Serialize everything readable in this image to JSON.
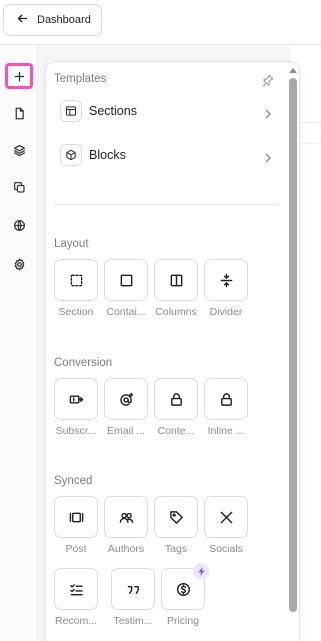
{
  "header": {
    "back_label": "Dashboard"
  },
  "rail": {
    "items": [
      {
        "name": "add",
        "active": true
      },
      {
        "name": "page"
      },
      {
        "name": "layers"
      },
      {
        "name": "copy"
      },
      {
        "name": "globe"
      },
      {
        "name": "settings"
      }
    ],
    "accent_color": "#ff4fbf"
  },
  "panel": {
    "templates": {
      "title": "Templates",
      "items": [
        {
          "label": "Sections",
          "icon": "layout-icon"
        },
        {
          "label": "Blocks",
          "icon": "cube-icon"
        }
      ]
    },
    "layout": {
      "title": "Layout",
      "items": [
        {
          "label": "Section",
          "icon": "dashed-square-icon"
        },
        {
          "label": "Contai...",
          "icon": "square-icon"
        },
        {
          "label": "Columns",
          "icon": "columns-icon"
        },
        {
          "label": "Divider",
          "icon": "divider-icon"
        }
      ]
    },
    "conversion": {
      "title": "Conversion",
      "items": [
        {
          "label": "Subscr...",
          "icon": "subscribe-icon"
        },
        {
          "label": "Email ...",
          "icon": "at-icon"
        },
        {
          "label": "Conte...",
          "icon": "lock-icon"
        },
        {
          "label": "Inline ...",
          "icon": "lock-icon"
        }
      ]
    },
    "synced": {
      "title": "Synced",
      "items": [
        {
          "label": "Post",
          "icon": "post-icon"
        },
        {
          "label": "Authors",
          "icon": "users-icon"
        },
        {
          "label": "Tags",
          "icon": "tag-icon"
        },
        {
          "label": "Socials",
          "icon": "x-logo-icon"
        },
        {
          "label": "Recom...",
          "icon": "checklist-icon"
        },
        {
          "label": "Testim...",
          "icon": "quote-icon"
        },
        {
          "label": "Pricing",
          "icon": "dollar-icon",
          "badge": "bolt-icon"
        }
      ]
    }
  }
}
